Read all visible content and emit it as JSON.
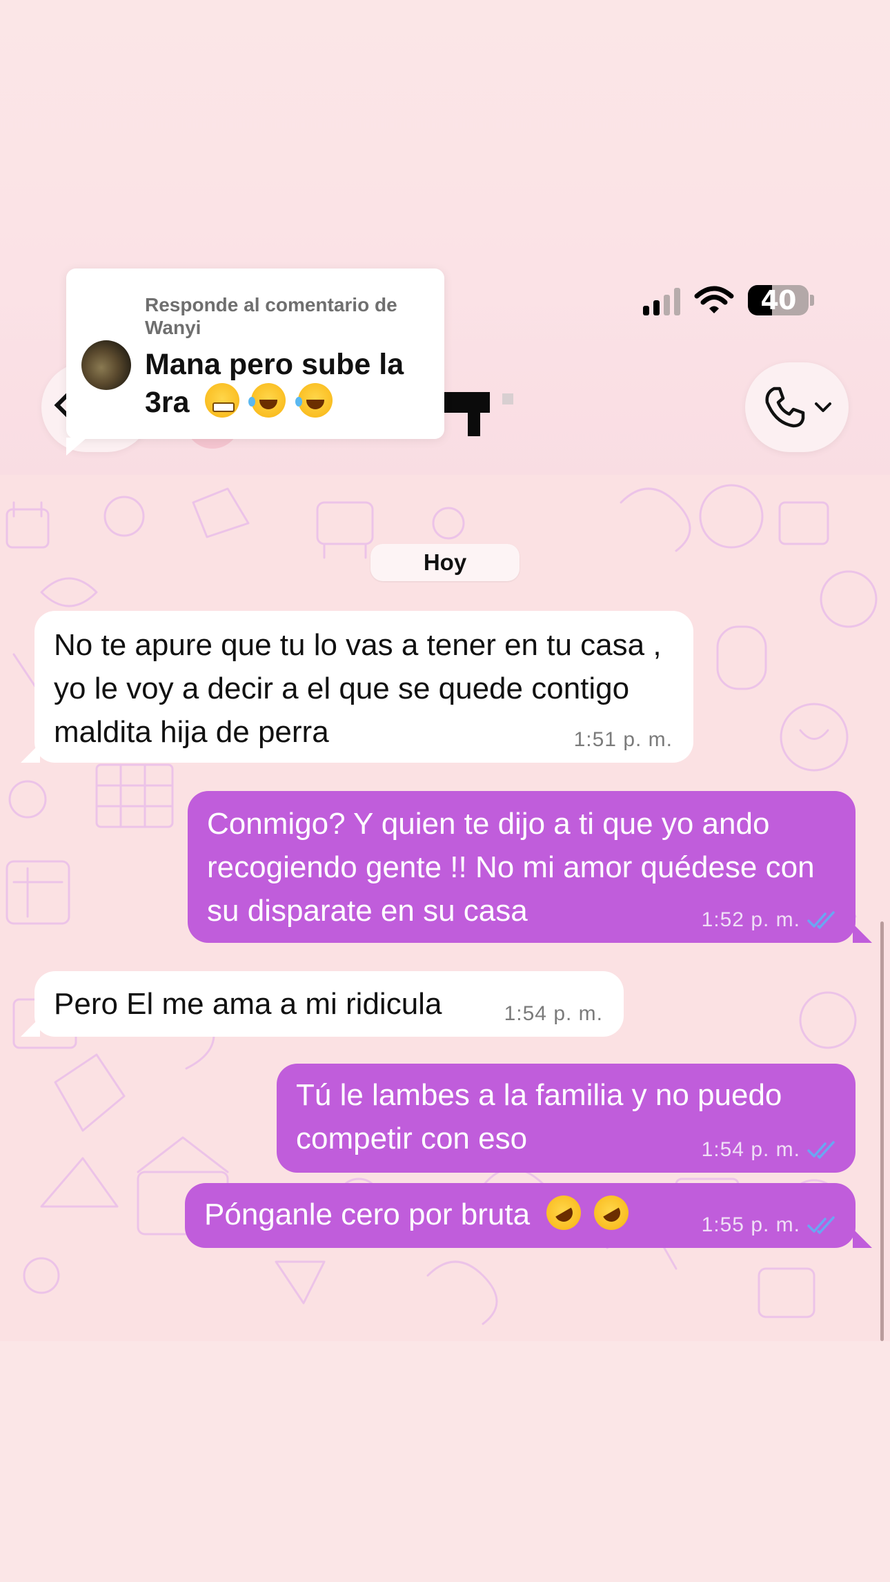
{
  "status_bar": {
    "battery_level": "40"
  },
  "reply_preview": {
    "meta": "Responde al comentario de Wanyi",
    "text": "Mana pero sube la 3ra",
    "emojis": [
      "grimacing-face",
      "face-with-tears-of-joy",
      "face-with-tears-of-joy"
    ]
  },
  "chat": {
    "date_label": "Hoy",
    "messages": [
      {
        "direction": "in",
        "text": "No te apure que tu lo vas a tener en tu casa , yo le voy a decir a el que se quede contigo maldita hija de perra",
        "time": "1:51 p. m."
      },
      {
        "direction": "out",
        "text": "Conmigo? Y quien te dijo a ti que yo ando recogiendo gente !! No mi amor quédese con su disparate en su casa",
        "time": "1:52 p. m.",
        "status": "read"
      },
      {
        "direction": "in",
        "text": "Pero El me ama a mi ridicula",
        "time": "1:54 p. m."
      },
      {
        "direction": "out",
        "text": "Tú le lambes a la familia y no puedo competir con eso",
        "time": "1:54 p. m.",
        "status": "read"
      },
      {
        "direction": "out",
        "text": "Pónganle cero por bruta",
        "emojis": [
          "rolling-on-the-floor-laughing",
          "rolling-on-the-floor-laughing"
        ],
        "time": "1:55 p. m.",
        "status": "read"
      }
    ]
  },
  "colors": {
    "background": "#fbe6e7",
    "chat_background": "#fbe1e3",
    "outgoing_bubble": "#c05ddb",
    "incoming_bubble": "#ffffff",
    "read_ticks": "#6aa7f2"
  },
  "icons": {
    "back": "chevron-left-icon",
    "call": "phone-icon",
    "call_menu": "chevron-down-icon",
    "read": "double-check-icon"
  }
}
